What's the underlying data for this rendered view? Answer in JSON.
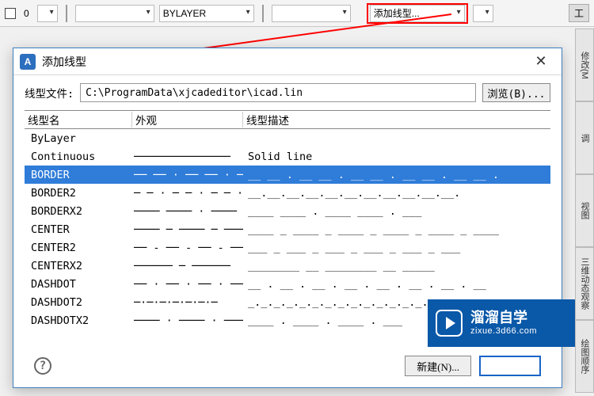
{
  "toolbar": {
    "layer_index": "0",
    "layer_name": "BYLAYER",
    "linetype_btn": "添加线型...",
    "tool_label": "工"
  },
  "sidetabs": [
    "修改(M",
    "调",
    "视图",
    "三维动态观察",
    "绘图顺序"
  ],
  "dialog": {
    "title": "添加线型",
    "file_label": "线型文件:",
    "file_path": "C:\\ProgramData\\xjcadeditor\\icad.lin",
    "browse_label": "浏览(B)...",
    "columns": {
      "name": "线型名",
      "appearance": "外观",
      "desc": "线型描述"
    },
    "rows": [
      {
        "name": "ByLayer",
        "app": "",
        "desc": ""
      },
      {
        "name": "Continuous",
        "app": "───────────────",
        "desc": "Solid line"
      },
      {
        "name": "BORDER",
        "app": "── ── · ── ── · ──",
        "desc": "__ __ . __ __ . __ __ . __ __ . __ __ ."
      },
      {
        "name": "BORDER2",
        "app": "─ ─ · ─ ─ · ─ ─ · ─",
        "desc": "__.__.__.__.__.__.__.__.__.__.__."
      },
      {
        "name": "BORDERX2",
        "app": "──── ──── · ────",
        "desc": "____  ____  .  ____  ____  .  ___"
      },
      {
        "name": "CENTER",
        "app": "──── ─ ──── ─ ────",
        "desc": "____ _ ____ _ ____ _ ____ _ ____ _ ____"
      },
      {
        "name": "CENTER2",
        "app": "── - ── - ── - ──",
        "desc": "___ _ ___ _ ___ _ ___ _ ___ _ ___"
      },
      {
        "name": "CENTERX2",
        "app": "────── ─ ──────",
        "desc": "________  __  ________  __  _____"
      },
      {
        "name": "DASHDOT",
        "app": "── · ── · ── · ──",
        "desc": "__ . __ . __ . __ . __ . __ . __ . __"
      },
      {
        "name": "DASHDOT2",
        "app": "─·─·─·─·─·─·─",
        "desc": "_._._._._._._._._._._._._._._."
      },
      {
        "name": "DASHDOTX2",
        "app": "──── · ──── · ────",
        "desc": "____  .  ____  .  ____  .  ___"
      }
    ],
    "selected_index": 2,
    "new_btn": "新建(N)...",
    "help_symbol": "?"
  },
  "brand": {
    "cn": "溜溜自学",
    "en": "zixue.3d66.com"
  }
}
